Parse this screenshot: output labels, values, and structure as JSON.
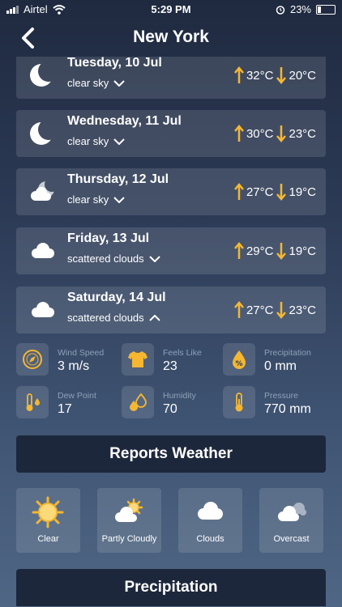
{
  "status": {
    "carrier": "Airtel",
    "time": "5:29 PM",
    "battery": "23%"
  },
  "header": {
    "title": "New York"
  },
  "days": [
    {
      "date": "Tuesday, 10 Jul",
      "desc": "clear sky",
      "icon": "moon-icon",
      "high": "32°C",
      "low": "20°C",
      "expanded": false
    },
    {
      "date": "Wednesday, 11 Jul",
      "desc": "clear sky",
      "icon": "moon-icon",
      "high": "30°C",
      "low": "23°C",
      "expanded": false
    },
    {
      "date": "Thursday, 12 Jul",
      "desc": "clear sky",
      "icon": "cloud-moon-icon",
      "high": "27°C",
      "low": "19°C",
      "expanded": false
    },
    {
      "date": "Friday, 13 Jul",
      "desc": "scattered clouds",
      "icon": "cloud-icon",
      "high": "29°C",
      "low": "19°C",
      "expanded": false
    },
    {
      "date": "Saturday, 14 Jul",
      "desc": "scattered clouds",
      "icon": "cloud-icon",
      "high": "27°C",
      "low": "23°C",
      "expanded": true
    }
  ],
  "details": [
    {
      "label": "Wind Speed",
      "value": "3 m/s",
      "icon": "compass-icon"
    },
    {
      "label": "Feels Like",
      "value": "23",
      "icon": "tshirt-icon"
    },
    {
      "label": "Precipitation",
      "value": "0 mm",
      "icon": "drop-percent-icon"
    },
    {
      "label": "Dew Point",
      "value": "17",
      "icon": "dew-thermometer-icon"
    },
    {
      "label": "Humidity",
      "value": "70",
      "icon": "droplets-icon"
    },
    {
      "label": "Pressure",
      "value": "770 mm",
      "icon": "thermometer-icon"
    }
  ],
  "reports_button": "Reports Weather",
  "tiles": [
    {
      "label": "Clear",
      "icon": "sun-icon"
    },
    {
      "label": "Partly Cloudly",
      "icon": "partly-cloudy-icon"
    },
    {
      "label": "Clouds",
      "icon": "cloud-icon"
    },
    {
      "label": "Overcast",
      "icon": "overcast-icon"
    }
  ],
  "precip_button": "Precipitation",
  "colors": {
    "accent": "#f5b731",
    "button_bg": "#1d273c",
    "label": "#8fa0b8"
  }
}
